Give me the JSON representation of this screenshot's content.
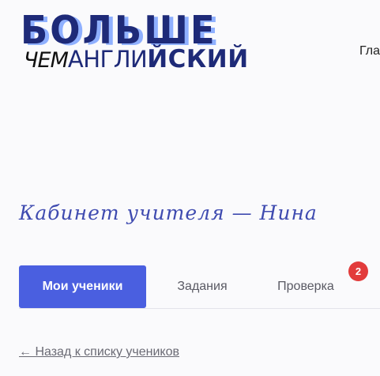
{
  "header": {
    "logo": {
      "line1": "БОЛЬШЕ",
      "line2_a": "ЧЕМ",
      "line2_b": "АНГЛИ",
      "line2_c": "ЙСКИЙ"
    },
    "nav_partial": "Гла"
  },
  "page": {
    "title": "Кабинет учителя — Нина"
  },
  "tabs": [
    {
      "label": "Мои ученики",
      "active": true
    },
    {
      "label": "Задания",
      "active": false
    },
    {
      "label": "Проверка",
      "active": false,
      "badge": "2"
    }
  ],
  "back_link": "← Назад к списку учеников",
  "colors": {
    "accent": "#4a5fe0",
    "badge": "#e23b3b",
    "logo_dark": "#1e2a78",
    "logo_shadow": "#8fb0ff",
    "title": "#3f4bb0"
  }
}
